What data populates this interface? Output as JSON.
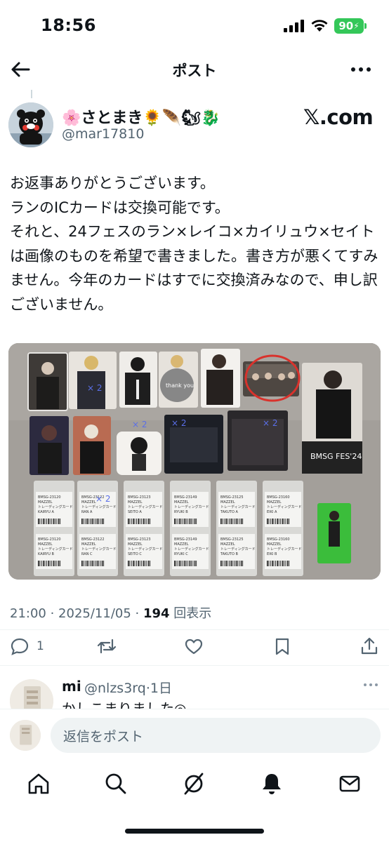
{
  "status_bar": {
    "time": "18:56",
    "battery": "90"
  },
  "header": {
    "title": "ポスト"
  },
  "post": {
    "author_name": "🌸さとまき🌻🪶🐿🐉",
    "author_handle": "@mar17810",
    "source_label": "𝕏.com",
    "text": "お返事ありがとうございます。\nランのICカードは交換可能です。\nそれと、24フェスのラン×レイコ×カイリュウ×セイトは画像のものを希望で書きました。書き方が悪くてすみません。今年のカードはすでに交換済みなので、申し訳ございません。",
    "image": {
      "overlay_labels": [
        "× 2",
        "× 2",
        "× 2",
        "× 2",
        "× 2"
      ],
      "card_text": "thank you",
      "poster_text": "BMSG FES'24",
      "packages": [
        {
          "code": "BMSG-23120",
          "brand": "MAZZEL",
          "kind": "トレーディングカード",
          "member": "KAIRYU A",
          "code2": "BMSG-23120",
          "member2": "KAIRYU B"
        },
        {
          "code": "BMSG-23122",
          "brand": "MAZZEL",
          "kind": "トレーディングカード",
          "member": "RAN A",
          "code2": "BMSG-23122",
          "member2": "RAN C"
        },
        {
          "code": "BMSG-23123",
          "brand": "MAZZEL",
          "kind": "トレーディングカード",
          "member": "SEITO A",
          "code2": "BMSG-23123",
          "member2": "SEITO C"
        },
        {
          "code": "BMSG-23149",
          "brand": "MAZZEL",
          "kind": "トレーディングカード",
          "member": "RYUKI B",
          "code2": "BMSG-23149",
          "member2": "RYUKI C"
        },
        {
          "code": "BMSG-23125",
          "brand": "MAZZEL",
          "kind": "トレーディングカード",
          "member": "TAKUTO A",
          "code2": "BMSG-23125",
          "member2": "TAKUTO B"
        },
        {
          "code": "BMSG-23160",
          "brand": "MAZZEL",
          "kind": "トレーディングカード",
          "member": "EIKI A",
          "code2": "BMSG-23160",
          "member2": "EIKI B"
        }
      ]
    },
    "time": "21:00",
    "date": "2025/11/05",
    "views": "194",
    "views_label": "回表示",
    "reply_count": "1"
  },
  "reply": {
    "name": "mi",
    "handle": "@nlzs3rq",
    "age": "1日",
    "text": "かしこまりました◎"
  },
  "compose": {
    "placeholder": "返信をポスト"
  },
  "colors": {
    "text": "#0f1419",
    "secondary": "#536471",
    "battery": "#34c759",
    "circle": "#d9322c"
  }
}
